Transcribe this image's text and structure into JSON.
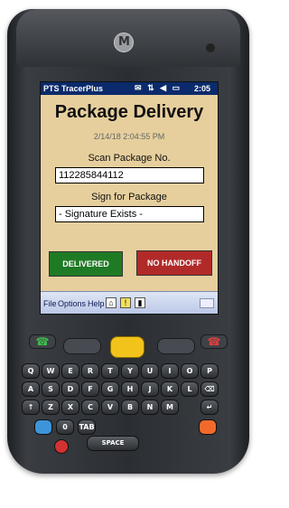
{
  "status": {
    "app_name": "PTS TracerPlus",
    "time": "2:05",
    "icons": [
      "envelope-icon",
      "network-icon",
      "sound-icon",
      "battery-icon"
    ]
  },
  "screen": {
    "title": "Package Delivery",
    "datetime": "2/14/18 2:04:55 PM",
    "scan_label": "Scan Package No.",
    "package_number": "112285844112",
    "sign_label": "Sign for Package",
    "signature_value": "- Signature Exists -",
    "delivered_button": "DELIVERED",
    "no_handoff_button": "NO HANDOFF"
  },
  "menu": {
    "file": "File",
    "options": "Options",
    "help": "Help"
  },
  "keypad": {
    "space_label": "SPACE",
    "tab_label": "TAB",
    "rows": [
      [
        "Q",
        "W",
        "E",
        "R",
        "T",
        "Y",
        "U",
        "I",
        "O",
        "P"
      ],
      [
        "A",
        "S",
        "D",
        "F",
        "G",
        "H",
        "J",
        "K",
        "L",
        "⌫"
      ],
      [
        "↑",
        "Z",
        "X",
        "C",
        "V",
        "B",
        "N",
        "M",
        "↵"
      ],
      [
        "",
        "",
        "",
        "",
        "",
        "",
        "",
        ""
      ]
    ],
    "subs": [
      [
        "",
        "",
        "1",
        "2",
        "3",
        "+",
        "-",
        "",
        "",
        ""
      ],
      [
        "",
        "4",
        "5",
        "6",
        "",
        "",
        "",
        "",
        "",
        ""
      ],
      [
        "",
        "",
        "7",
        "8",
        "9",
        "",
        "",
        "",
        "",
        ""
      ]
    ]
  },
  "colors": {
    "screen_bg": "#e6cf9d",
    "delivered": "#1f7a25",
    "no_handoff": "#b12a2a",
    "scan_key": "#f2c31b"
  }
}
